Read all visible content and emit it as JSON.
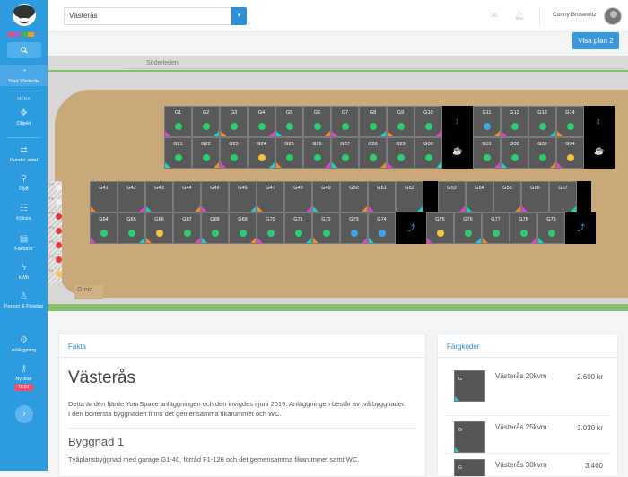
{
  "sidebar": {
    "color_stripes": [
      "#e94f72",
      "#a35fd1",
      "#4caf50",
      "#f59c1a",
      "#4a90d9"
    ],
    "menu_head": "MENY",
    "items": [
      {
        "label": "Start Västerås",
        "icon": "gauge-icon"
      },
      {
        "label": "Objekt",
        "icon": "cubes-icon"
      },
      {
        "label": "Kunder avtal",
        "icon": "handshake-icon"
      },
      {
        "label": "Flytt",
        "icon": "walk-icon"
      },
      {
        "label": "Kölista",
        "icon": "users-icon"
      },
      {
        "label": "Fakturor",
        "icon": "invoice-icon"
      },
      {
        "label": "kWh",
        "icon": "bolt-icon"
      },
      {
        "label": "Person & Företag",
        "icon": "person-icon"
      },
      {
        "label": "Anläggning",
        "icon": "gear-icon"
      },
      {
        "label": "Nycklar",
        "icon": "key-icon"
      }
    ],
    "test_badge": "TEST"
  },
  "topbar": {
    "facility": "Västerås",
    "user": "Conny Brusewitz"
  },
  "visa_plan": "Visa plan 2",
  "map": {
    "road": "Söderleden",
    "gate": "Grind",
    "parking": [
      "P7",
      "P6",
      "P5",
      "P4",
      "P3",
      "P2",
      "P1"
    ],
    "parking_colors": [
      "#f0f0f0",
      "#f0f0f0",
      "#e53935",
      "#e53935",
      "#e53935",
      "#e53935",
      "#f2c94c"
    ],
    "rows": [
      {
        "units": [
          "G1",
          "G2",
          "G3",
          "G4",
          "G5",
          "G6",
          "G7",
          "G8",
          "G9",
          "G10",
          "",
          "G11",
          "G12",
          "G13",
          "G14",
          ""
        ],
        "dots": [
          "g",
          "g",
          "g",
          "g",
          "g",
          "g",
          "g",
          "g",
          "g",
          "g",
          "",
          "b",
          "g",
          "g",
          "g",
          ""
        ]
      },
      {
        "units": [
          "G21",
          "G22",
          "G23",
          "G24",
          "G25",
          "G26",
          "G27",
          "G28",
          "G29",
          "G30",
          "",
          "G31",
          "G32",
          "G33",
          "G34",
          ""
        ],
        "dots": [
          "g",
          "g",
          "g",
          "y",
          "g",
          "g",
          "g",
          "g",
          "g",
          "g",
          "",
          "g",
          "g",
          "g",
          "y",
          ""
        ]
      },
      {
        "units": [
          "G41",
          "G42",
          "G43",
          "G44",
          "G45",
          "G46",
          "G47",
          "G48",
          "G49",
          "G50",
          "G51",
          "G52",
          "",
          "G53",
          "G54",
          "G55",
          "G56",
          "G57",
          ""
        ],
        "dots": [
          "",
          "",
          "",
          "",
          "",
          "",
          "",
          "",
          "",
          "",
          "",
          "",
          "",
          "",
          "",
          "",
          "",
          "",
          ""
        ]
      },
      {
        "units": [
          "G64",
          "G65",
          "G66",
          "G67",
          "G68",
          "G69",
          "G70",
          "G71",
          "G72",
          "G73",
          "G74",
          "",
          "G75",
          "G76",
          "G77",
          "G78",
          "G79",
          ""
        ],
        "dots": [
          "g",
          "g",
          "y",
          "g",
          "g",
          "g",
          "g",
          "g",
          "g",
          "b",
          "b",
          "",
          "y",
          "g",
          "g",
          "g",
          "g",
          ""
        ]
      }
    ]
  },
  "fakta": {
    "header": "Fakta",
    "title": "Västerås",
    "text": "Detta är den fjärde YourSpace anläggningen och den invigdes i juni 2019. Anläggningen består av två byggnader. I den bortersta byggnaden finns det gemensamma fikarummet och WC.",
    "section_title": "Byggnad 1",
    "section_text": "Tvåplansbyggnad med garage G1-40, förråd F1-126 och det gemensamma fikarummet samt WC."
  },
  "fargkoder": {
    "header": "Färgkoder",
    "items": [
      {
        "name": "Västerås 20kvm",
        "price": "2.600 kr"
      },
      {
        "name": "Västerås 25kvm",
        "price": "3.030 kr"
      },
      {
        "name": "Västerås 30kvm",
        "price": "3.460"
      }
    ]
  }
}
